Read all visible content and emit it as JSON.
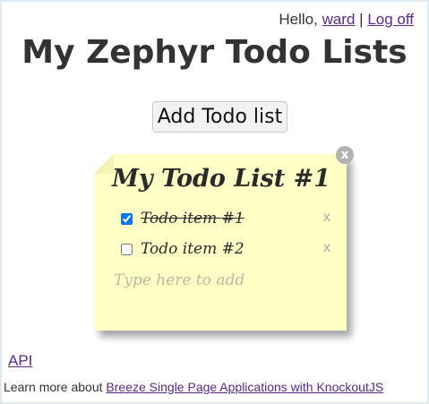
{
  "header": {
    "greeting": "Hello,",
    "user_name": "ward",
    "separator": "|",
    "logoff_label": "Log off"
  },
  "page_title": "My Zephyr Todo Lists",
  "add_list_button": "Add Todo list",
  "todo_list": {
    "title": "My Todo List #1",
    "delete_glyph": "x",
    "items": [
      {
        "text": "Todo item #1",
        "done": true,
        "delete_glyph": "x"
      },
      {
        "text": "Todo item #2",
        "done": false,
        "delete_glyph": "x"
      }
    ],
    "add_placeholder": "Type here to add"
  },
  "footer": {
    "api_link": "API",
    "learn_more_text": "Learn more about",
    "learn_more_link": "Breeze Single Page Applications with KnockoutJS"
  },
  "colors": {
    "note_background": "#ffffc6",
    "link": "#5b2a86",
    "text": "#333333"
  }
}
